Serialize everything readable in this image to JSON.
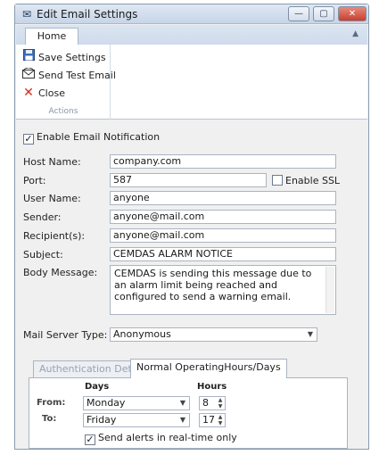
{
  "window": {
    "title": "Edit Email Settings",
    "icon": "envelope-icon",
    "accent_color": "#c9d7ea",
    "close_color": "#c5412f"
  },
  "titlebar_buttons": {
    "minimize": "—",
    "maximize": "▢",
    "close": "✕"
  },
  "ribbon": {
    "tab": "Home",
    "group_label": "Actions",
    "actions": [
      {
        "label": "Save Settings",
        "icon": "floppy-disk-icon"
      },
      {
        "label": "Send Test Email",
        "icon": "envelope-send-icon"
      },
      {
        "label": "Close",
        "icon": "red-x-icon"
      }
    ]
  },
  "form": {
    "enable_label": "Enable Email Notification",
    "enable_checked": true,
    "host_label": "Host Name:",
    "host_value": "company.com",
    "port_label": "Port:",
    "port_value": "587",
    "ssl_label": "Enable SSL",
    "ssl_checked": false,
    "user_label": "User Name:",
    "user_value": "anyone",
    "sender_label": "Sender:",
    "sender_value": "anyone@mail.com",
    "recipient_label": "Recipient(s):",
    "recipient_value": "anyone@mail.com",
    "subject_label": "Subject:",
    "subject_value": "CEMDAS ALARM NOTICE",
    "body_label": "Body Message:",
    "body_value": "CEMDAS is sending this message due to an alarm limit being reached and configured to send a warning email.",
    "server_type_label": "Mail Server Type:",
    "server_type_value": "Anonymous"
  },
  "tabs": [
    "Authentication Details",
    "Normal OperatingHours/Days"
  ],
  "hours": {
    "days_header": "Days",
    "hours_header": "Hours",
    "from_label": "From:",
    "from_day": "Monday",
    "from_hour": "8",
    "to_label": "To:",
    "to_day": "Friday",
    "to_hour": "17",
    "realtime_label": "Send alerts in real-time only",
    "realtime_checked": true
  }
}
